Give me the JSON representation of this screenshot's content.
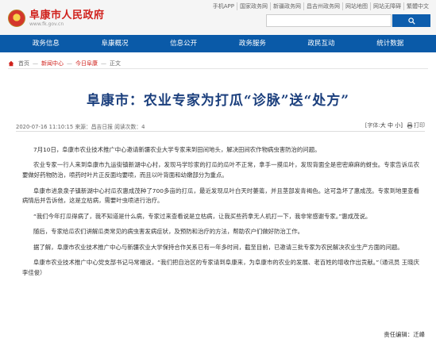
{
  "header": {
    "logo_title": "阜康市人民政府",
    "logo_url": "www.fk.gov.cn",
    "util_links": [
      "手机APP",
      "国家政务网",
      "新疆政务网",
      "昌吉州政务网",
      "网站地图",
      "网站无障碍",
      "繁體中文"
    ],
    "search_placeholder": ""
  },
  "nav": {
    "items": [
      "政务信息",
      "阜康概况",
      "信息公开",
      "政务服务",
      "政民互动",
      "统计数据"
    ]
  },
  "breadcrumb": {
    "items": [
      "首页",
      "新闻中心",
      "今日阜康",
      "正文"
    ]
  },
  "article": {
    "title": "阜康市：农业专家为打瓜“诊脉”送“处方”",
    "meta_left": "2020-07-16 11:10:15 来源：昌吉日报 阅读次数：4",
    "font_label": "[字体:",
    "font_big": "大",
    "font_mid": "中",
    "font_small": "小]",
    "print_label": "打印",
    "paragraphs": [
      "7月10日，阜康市农业技术推广中心邀请新疆农业大学专家来到田间地头，解决田间农作物病虫害防治的问题。",
      "农业专家一行人来到阜康市九运街镇新湖中心村，发现马学珍家的打瓜的瓜叶不正常，拿手一摸瓜叶，发现背面全是密密麻麻的蚜虫。专家告诉瓜农要做好药物防治，喷药时叶片正反面均要喷，而且以叶背面和幼嫩部分为重点。",
      "阜康市进泉泉子镇新湖中心村瓜农惠成茂种了700多亩的打瓜，最近发现瓜叶白天时萎蔫，并且茎部发青褐色。这可急坏了惠成茂。专家到地里查看病情后并告诉他，这是立枯病，需要叶虫喷进行治疗。",
      "“我们今年打瓜得病了，我不知道是什么病，专家过来查看说是立枯病，让我买些药拿无人机打一下，我非常感谢专家。”惠成茂说。",
      "随后，专家给瓜农们讲解瓜类常见的病虫害发病症状，及预防和治疗的方法，帮助农户们做好防治工作。",
      "据了解，阜康市农业技术推广中心与新疆农业大学保持合作关系已有一年多时间，截至目前，已邀请三批专家为农民解决农业生产方面的问题。",
      "阜康市农业技术推广中心党支部书记马常福说，“我们把自治区的专家请到阜康来，为阜康市的农业的发展、老百姓的增收作出贡献。”（通讯员 王晓庆 李佳俊）"
    ],
    "editor": "责任编辑：迁峰"
  }
}
